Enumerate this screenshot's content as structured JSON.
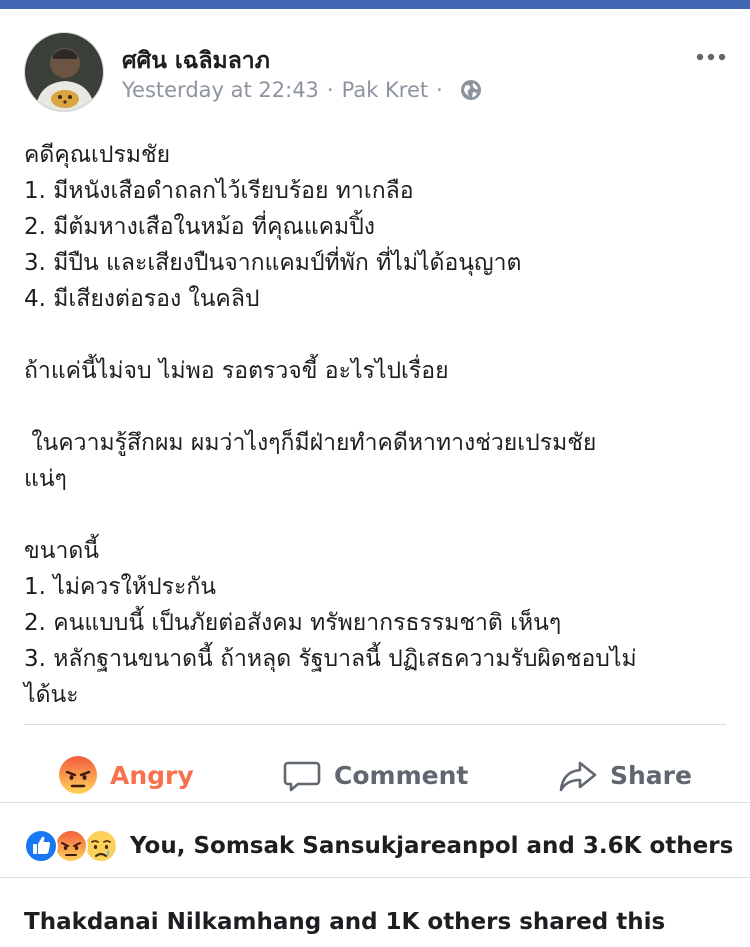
{
  "post": {
    "author": "ศศิน เฉลิมลาภ",
    "time": "Yesterday at 22:43",
    "location": "Pak Kret",
    "separator": "·",
    "lines": [
      "คดีคุณเปรมชัย",
      "1. มีหนังเสือดำถลกไว้เรียบร้อย ทาเกลือ",
      "2. มีต้มหางเสือในหม้อ ที่คุณแคมปิ้ง",
      "3. มีปืน และเสียงปืนจากแคมป์ที่พัก ที่ไม่ได้อนุญาต",
      "4. มีเสียงต่อรอง ในคลิป",
      "",
      "ถ้าแค่นี้ไม่จบ ไม่พอ รอตรวจขี้ อะไรไปเรื่อย",
      "",
      " ในความรู้สึกผม ผมว่าไงๆก็มีฝ่ายทำคดีหาทางช่วยเปรมชัย",
      "แน่ๆ",
      "",
      "ขนาดนี้",
      "1. ไม่ควรให้ประกัน",
      "2. คนแบบนี้ เป็นภัยต่อสังคม ทรัพยากรธรรมชาติ เห็นๆ",
      "3. หลักฐานขนาดนี้ ถ้าหลุด รัฐบาลนี้ ปฏิเสธความรับผิดชอบไม่",
      "ได้นะ"
    ]
  },
  "actions": {
    "angry_label": "Angry",
    "comment_label": "Comment",
    "share_label": "Share"
  },
  "reactions": {
    "text": "You, Somsak Sansukjareanpol and 3.6K others",
    "icons": [
      "like-icon",
      "angry-icon",
      "sad-icon"
    ]
  },
  "shares": {
    "text": "Thakdanai Nilkamhang and 1K others shared this"
  },
  "colors": {
    "top_bar": "#4267b2",
    "angry": "#f7714c",
    "action_gray": "#606770",
    "meta_gray": "#8d949e",
    "like_blue": "#1877f2"
  }
}
